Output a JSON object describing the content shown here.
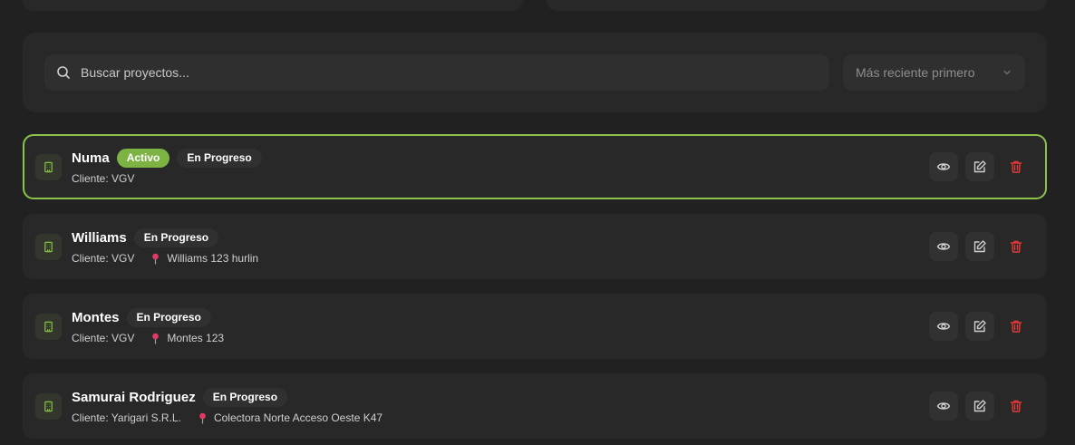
{
  "search": {
    "placeholder": "Buscar proyectos..."
  },
  "sort": {
    "selected": "Más reciente primero"
  },
  "colors": {
    "accent": "#8bc34a",
    "badge_active": "#7cb342",
    "delete": "#e53935"
  },
  "projects": [
    {
      "name": "Numa",
      "active_badge": "Activo",
      "status": "En Progreso",
      "client": "Cliente: VGV",
      "address": ""
    },
    {
      "name": "Williams",
      "active_badge": "",
      "status": "En Progreso",
      "client": "Cliente: VGV",
      "address": "Williams 123 hurlin"
    },
    {
      "name": "Montes",
      "active_badge": "",
      "status": "En Progreso",
      "client": "Cliente: VGV",
      "address": "Montes 123"
    },
    {
      "name": "Samurai Rodriguez",
      "active_badge": "",
      "status": "En Progreso",
      "client": "Cliente: Yarigari S.R.L.",
      "address": "Colectora Norte Acceso Oeste K47"
    }
  ],
  "icons": {
    "search": "search-icon",
    "sort": "chevron-down-icon",
    "building": "building-icon",
    "location": "map-pin-icon",
    "view": "eye-icon",
    "edit": "edit-icon",
    "delete": "trash-icon"
  }
}
